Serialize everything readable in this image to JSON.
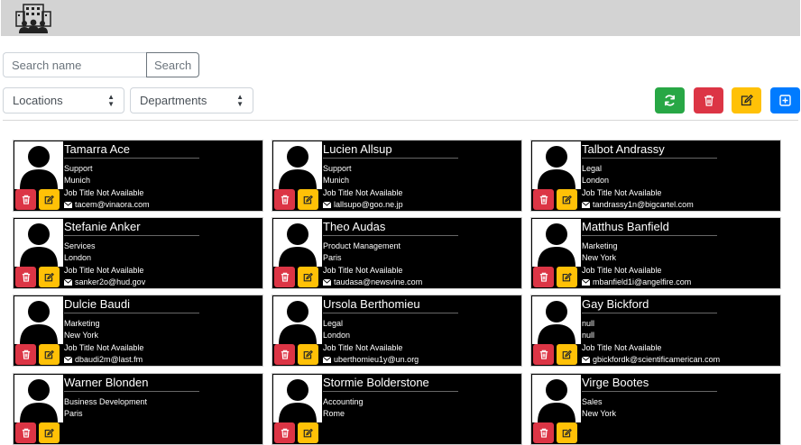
{
  "search": {
    "placeholder": "Search name",
    "button_label": "Search"
  },
  "filters": {
    "locations": "Locations",
    "departments": "Departments"
  },
  "colors": {
    "refresh": "#28a745",
    "delete": "#dc3545",
    "edit": "#ffc107",
    "add": "#007bff"
  },
  "icons": {
    "logo": "office-building-people-icon",
    "refresh": "refresh-icon",
    "delete": "trash-icon",
    "edit": "edit-icon",
    "add": "plus-square-icon",
    "email": "envelope-icon",
    "avatar": "user-silhouette-icon"
  },
  "employees": [
    {
      "name": "Tamarra Ace",
      "department": "Support",
      "location": "Munich",
      "job_title": "Job Title Not Available",
      "email": "tacem@vinaora.com"
    },
    {
      "name": "Lucien Allsup",
      "department": "Support",
      "location": "Munich",
      "job_title": "Job Title Not Available",
      "email": "lallsupo@goo.ne.jp"
    },
    {
      "name": "Talbot Andrassy",
      "department": "Legal",
      "location": "London",
      "job_title": "Job Title Not Available",
      "email": "tandrassy1n@bigcartel.com"
    },
    {
      "name": "Stefanie Anker",
      "department": "Services",
      "location": "London",
      "job_title": "Job Title Not Available",
      "email": "sanker2o@hud.gov"
    },
    {
      "name": "Theo Audas",
      "department": "Product Management",
      "location": "Paris",
      "job_title": "Job Title Not Available",
      "email": "taudasa@newsvine.com"
    },
    {
      "name": "Matthus Banfield",
      "department": "Marketing",
      "location": "New York",
      "job_title": "Job Title Not Available",
      "email": "mbanfield1i@angelfire.com"
    },
    {
      "name": "Dulcie Baudi",
      "department": "Marketing",
      "location": "New York",
      "job_title": "Job Title Not Available",
      "email": "dbaudi2m@last.fm"
    },
    {
      "name": "Ursola Berthomieu",
      "department": "Legal",
      "location": "London",
      "job_title": "Job Title Not Available",
      "email": "uberthomieu1y@un.org"
    },
    {
      "name": "Gay Bickford",
      "department": "null",
      "location": "null",
      "job_title": "Job Title Not Available",
      "email": "gbickfordk@scientificamerican.com"
    },
    {
      "name": "Warner Blonden",
      "department": "Business Development",
      "location": "Paris",
      "job_title": "",
      "email": ""
    },
    {
      "name": "Stormie Bolderstone",
      "department": "Accounting",
      "location": "Rome",
      "job_title": "",
      "email": ""
    },
    {
      "name": "Virge Bootes",
      "department": "Sales",
      "location": "New York",
      "job_title": "",
      "email": ""
    }
  ]
}
